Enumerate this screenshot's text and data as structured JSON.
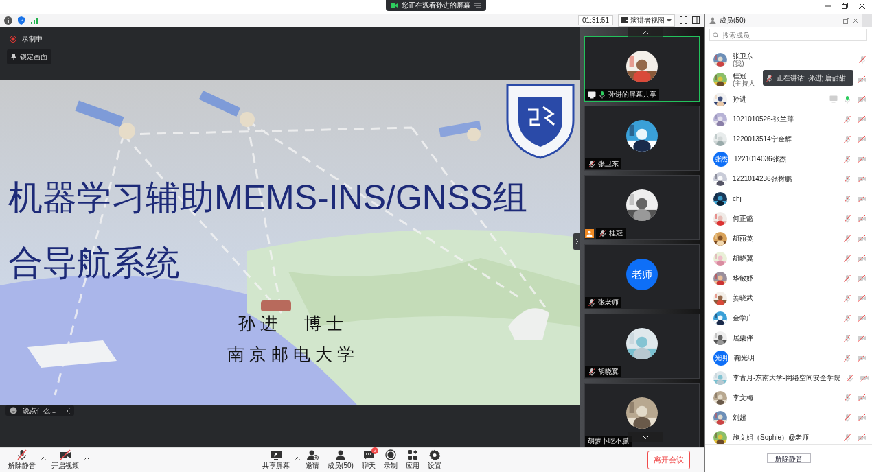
{
  "title_bar": {
    "banner": "您正在观看孙进的屏幕"
  },
  "toolbar": {
    "timer": "01:31:51",
    "view_button": "演讲者视图"
  },
  "stage": {
    "recording": "录制中",
    "lock_button": "锁定画面",
    "chat_input": {
      "placeholder": "说点什么..."
    }
  },
  "slide": {
    "title_lines": [
      "机器学习辅助MEMS-INS/GNSS组",
      "合导航系统"
    ],
    "author": "孙进　博士",
    "affiliation": "南京邮电大学"
  },
  "videos": [
    {
      "name": "孙进的屏幕共享",
      "selected": true,
      "mic_icon": true,
      "muted": false,
      "sharing": true,
      "host": false
    },
    {
      "name": "张卫东",
      "selected": false,
      "mic_icon": true,
      "muted": true,
      "sharing": false,
      "host": false
    },
    {
      "name": "桂冠",
      "selected": false,
      "mic_icon": true,
      "muted": true,
      "sharing": false,
      "host": true
    },
    {
      "name": "张老师",
      "selected": false,
      "mic_icon": true,
      "muted": true,
      "sharing": false,
      "host": false,
      "avatar": {
        "kind": "text",
        "text": "老师"
      }
    },
    {
      "name": "胡晓翼",
      "selected": false,
      "mic_icon": true,
      "muted": true,
      "sharing": false,
      "host": false
    },
    {
      "name": "胡萝卜吃不腻",
      "selected": false,
      "mic_icon": false,
      "sharing": false,
      "host": false
    }
  ],
  "panel": {
    "title": "成员(50)",
    "search": {
      "placeholder": "搜索成员"
    },
    "tooltip": "正在讲话: 孙进; 唐甜甜",
    "footer_button": "解除静音",
    "members": [
      {
        "name": "张卫东",
        "note": "(我)",
        "mic_icon": true,
        "muted": true,
        "video_icon": false,
        "sharing": false
      },
      {
        "name": "桂冠",
        "note": "(主持人",
        "mic_icon": false,
        "video_icon": true,
        "sharing": false
      },
      {
        "name": "孙进",
        "mic_icon": true,
        "muted": false,
        "video_icon": true,
        "sharing": true
      },
      {
        "name": "1021010526-张兰萍",
        "mic_icon": true,
        "muted": true,
        "video_icon": true,
        "sharing": false
      },
      {
        "name": "1220013514宁金辉",
        "mic_icon": true,
        "muted": true,
        "video_icon": true,
        "sharing": false
      },
      {
        "name": "1221014036张杰",
        "avatar": {
          "kind": "text",
          "text": "张杰"
        },
        "mic_icon": true,
        "muted": true,
        "video_icon": true,
        "sharing": false
      },
      {
        "name": "1221014236张树鹏",
        "mic_icon": true,
        "muted": true,
        "video_icon": true,
        "sharing": false
      },
      {
        "name": "chj",
        "mic_icon": true,
        "muted": true,
        "video_icon": true,
        "sharing": false
      },
      {
        "name": "何正懿",
        "mic_icon": true,
        "muted": true,
        "video_icon": true,
        "sharing": false
      },
      {
        "name": "胡丽英",
        "mic_icon": true,
        "muted": true,
        "video_icon": true,
        "sharing": false
      },
      {
        "name": "胡晓翼",
        "mic_icon": true,
        "muted": true,
        "video_icon": true,
        "sharing": false
      },
      {
        "name": "华敏妤",
        "mic_icon": true,
        "muted": true,
        "video_icon": true,
        "sharing": false
      },
      {
        "name": "姜晓武",
        "mic_icon": true,
        "muted": true,
        "video_icon": true,
        "sharing": false
      },
      {
        "name": "金学广",
        "mic_icon": true,
        "muted": true,
        "video_icon": true,
        "sharing": false
      },
      {
        "name": "居栗伴",
        "mic_icon": true,
        "muted": true,
        "video_icon": true,
        "sharing": false
      },
      {
        "name": "鞠光明",
        "avatar": {
          "kind": "text",
          "text": "光明"
        },
        "mic_icon": true,
        "muted": true,
        "video_icon": true,
        "sharing": false
      },
      {
        "name": "李古月-东南大学-网络空间安全学院",
        "mic_icon": true,
        "muted": true,
        "video_icon": true,
        "sharing": false
      },
      {
        "name": "李文梅",
        "mic_icon": true,
        "muted": true,
        "video_icon": true,
        "sharing": false
      },
      {
        "name": "刘超",
        "mic_icon": true,
        "muted": true,
        "video_icon": true,
        "sharing": false
      },
      {
        "name": "施文娟（Sophie）@老师",
        "mic_icon": true,
        "muted": true,
        "video_icon": true,
        "sharing": false
      }
    ]
  },
  "bottom_bar": {
    "items": [
      {
        "kind": "mic-muted",
        "label": "解除静音",
        "caret": true
      },
      {
        "kind": "video-off",
        "label": "开启视频",
        "caret": true
      },
      {
        "kind": "share",
        "label": "共享屏幕",
        "caret": true
      },
      {
        "kind": "invite",
        "label": "邀请",
        "caret": false
      },
      {
        "kind": "members",
        "label": "成员(50)",
        "caret": false
      },
      {
        "kind": "chat",
        "label": "聊天",
        "caret": false,
        "badge": "2"
      },
      {
        "kind": "record",
        "label": "录制",
        "caret": false
      },
      {
        "kind": "apps",
        "label": "应用",
        "caret": false
      },
      {
        "kind": "settings",
        "label": "设置",
        "caret": false
      }
    ],
    "leave_button": "离开会议"
  }
}
